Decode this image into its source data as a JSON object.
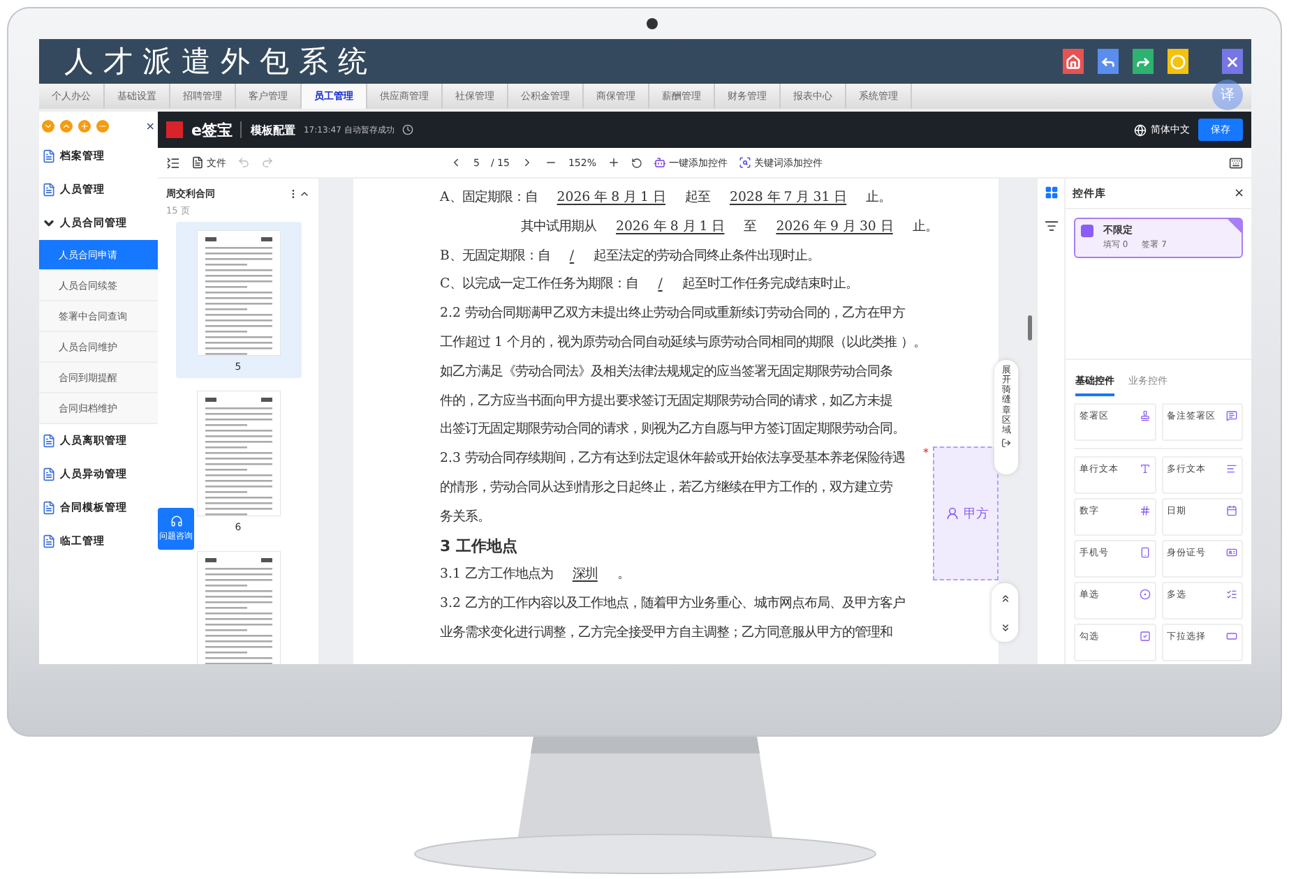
{
  "app": {
    "title": "人才派遣外包系统",
    "header_buttons": [
      {
        "kind": "home",
        "color": "#e55353"
      },
      {
        "kind": "back",
        "color": "#5b8def"
      },
      {
        "kind": "forward",
        "color": "#2db36f"
      },
      {
        "kind": "circle",
        "color": "#f4c20d"
      },
      {
        "kind": "close",
        "color": "#7676e6"
      }
    ],
    "nav_tabs": [
      {
        "label": "个人办公",
        "selected": false
      },
      {
        "label": "基础设置",
        "selected": false
      },
      {
        "label": "招聘管理",
        "selected": false
      },
      {
        "label": "客户管理",
        "selected": false
      },
      {
        "label": "员工管理",
        "selected": true
      },
      {
        "label": "供应商管理",
        "selected": false
      },
      {
        "label": "社保管理",
        "selected": false
      },
      {
        "label": "公积金管理",
        "selected": false
      },
      {
        "label": "商保管理",
        "selected": false
      },
      {
        "label": "薪酬管理",
        "selected": false
      },
      {
        "label": "财务管理",
        "selected": false
      },
      {
        "label": "报表中心",
        "selected": false
      },
      {
        "label": "系统管理",
        "selected": false
      }
    ],
    "translate_badge": "译",
    "sidebar": {
      "close": "×",
      "items": [
        {
          "label": "档案管理",
          "expanded": false
        },
        {
          "label": "人员管理",
          "expanded": false
        },
        {
          "label": "人员合同管理",
          "expanded": true,
          "children": [
            {
              "label": "人员合同申请",
              "selected": true
            },
            {
              "label": "人员合同续签",
              "selected": false
            },
            {
              "label": "签署中合同查询",
              "selected": false
            },
            {
              "label": "人员合同维护",
              "selected": false
            },
            {
              "label": "合同到期提醒",
              "selected": false
            },
            {
              "label": "合同归档维护",
              "selected": false
            }
          ]
        },
        {
          "label": "人员离职管理",
          "expanded": false
        },
        {
          "label": "人员异动管理",
          "expanded": false
        },
        {
          "label": "合同模板管理",
          "expanded": false
        },
        {
          "label": "临工管理",
          "expanded": false
        }
      ]
    }
  },
  "esign": {
    "brand": "e签宝",
    "title": "模板配置",
    "save_status": "17:13:47 自动暂存成功",
    "language": "简体中文",
    "save_button": "保存",
    "toolbar": {
      "file": "文件",
      "page": "5",
      "page_total": "/ 15",
      "zoom": "152%",
      "auto_add": "一键添加控件",
      "keyword_add": "关键词添加控件"
    },
    "document": {
      "name": "周交利合同",
      "pages": "15 页",
      "thumbnails": [
        {
          "label": "5",
          "selected": true
        },
        {
          "label": "6",
          "selected": false
        },
        {
          "selected": false
        }
      ]
    },
    "help_button": "问题咨询",
    "content": [
      {
        "kind": "line",
        "parts": [
          {
            "text": "A、固定期限：自",
            "underlined": false
          },
          {
            "text": "2026 年 8 月 1 日",
            "underlined": true
          },
          {
            "text": "起至",
            "underlined": false
          },
          {
            "text": "2028 年 7 月 31 日",
            "underlined": true
          },
          {
            "text": "止。",
            "underlined": false
          }
        ]
      },
      {
        "kind": "indent",
        "parts": [
          {
            "text": "其中试用期从",
            "underlined": false
          },
          {
            "text": "2026 年 8 月 1 日",
            "underlined": true
          },
          {
            "text": "至",
            "underlined": false
          },
          {
            "text": "2026 年 9 月 30 日",
            "underlined": true
          },
          {
            "text": "止。",
            "underlined": false
          }
        ]
      },
      {
        "kind": "line",
        "parts": [
          {
            "text": "B、无固定期限：自",
            "underlined": false
          },
          {
            "text": "/",
            "underlined": true
          },
          {
            "text": "起至法定的劳动合同终止条件出现时止。",
            "underlined": false
          }
        ]
      },
      {
        "kind": "line",
        "parts": [
          {
            "text": "C、以完成一定工作任务为期限：自",
            "underlined": false
          },
          {
            "text": "/",
            "underlined": true
          },
          {
            "text": "起至时工作任务完成结束时止。",
            "underlined": false
          }
        ]
      },
      {
        "kind": "line",
        "parts": [
          {
            "text": "2.2 劳动合同期满甲乙双方未提出终止劳动合同或重新续订劳动合同的，乙方在甲方",
            "underlined": false
          }
        ]
      },
      {
        "kind": "line",
        "parts": [
          {
            "text": "工作超过 1 个月的，视为原劳动合同自动延续与原劳动合同相同的期限（以此类推 ）。",
            "underlined": false
          }
        ]
      },
      {
        "kind": "line",
        "parts": [
          {
            "text": "如乙方满足《劳动合同法》及相关法律法规规定的应当签署无固定期限劳动合同条",
            "underlined": false
          }
        ]
      },
      {
        "kind": "line",
        "parts": [
          {
            "text": "件的，乙方应当书面向甲方提出要求签订无固定期限劳动合同的请求，如乙方未提",
            "underlined": false
          }
        ]
      },
      {
        "kind": "line",
        "parts": [
          {
            "text": "出签订无固定期限劳动合同的请求，则视为乙方自愿与甲方签订固定期限劳动合同。",
            "underlined": false
          }
        ]
      },
      {
        "kind": "line",
        "parts": [
          {
            "text": "2.3 劳动合同存续期间，乙方有达到法定退休年龄或开始依法享受基本养老保险待遇",
            "underlined": false
          }
        ]
      },
      {
        "kind": "line",
        "parts": [
          {
            "text": "的情形，劳动合同从达到情形之日起终止，若乙方继续在甲方工作的，双方建立劳",
            "underlined": false
          }
        ]
      },
      {
        "kind": "line",
        "parts": [
          {
            "text": "务关系。",
            "underlined": false
          }
        ]
      },
      {
        "kind": "heading",
        "parts": [
          {
            "text": "3 工作地点",
            "underlined": false
          }
        ]
      },
      {
        "kind": "line",
        "parts": [
          {
            "text": "3.1 乙方工作地点为",
            "underlined": false
          },
          {
            "text": "深圳",
            "underlined": true
          },
          {
            "text": "。",
            "underlined": false
          }
        ]
      },
      {
        "kind": "line",
        "parts": [
          {
            "text": "3.2 乙方的工作内容以及工作地点，随着甲方业务重心、城市网点布局、及甲方客户",
            "underlined": false
          }
        ]
      },
      {
        "kind": "line",
        "parts": [
          {
            "text": "业务需求变化进行调整，乙方完全接受甲方自主调整；乙方同意服从甲方的管理和",
            "underlined": false
          }
        ]
      }
    ],
    "signature_box": {
      "label": "甲方",
      "required": "*"
    },
    "seam_seal": "展开骑缝章区域",
    "panel": {
      "title": "控件库",
      "close": "×",
      "signer": {
        "name": "不限定",
        "fill": "填写 0",
        "sign": "签署 7",
        "selected": true
      },
      "tabs": [
        {
          "label": "基础控件",
          "selected": true
        },
        {
          "label": "业务控件",
          "selected": false
        }
      ],
      "sign_controls": [
        {
          "label": "签署区",
          "kind": "stamp"
        },
        {
          "label": "备注签署区",
          "kind": "note"
        }
      ],
      "controls": [
        {
          "label": "单行文本",
          "kind": "text"
        },
        {
          "label": "多行文本",
          "kind": "multiline"
        },
        {
          "label": "数字",
          "kind": "number"
        },
        {
          "label": "日期",
          "kind": "date"
        },
        {
          "label": "手机号",
          "kind": "phone"
        },
        {
          "label": "身份证号",
          "kind": "idcard"
        },
        {
          "label": "单选",
          "kind": "radio"
        },
        {
          "label": "多选",
          "kind": "multi"
        },
        {
          "label": "勾选",
          "kind": "check"
        },
        {
          "label": "下拉选择",
          "kind": "select"
        }
      ]
    }
  }
}
